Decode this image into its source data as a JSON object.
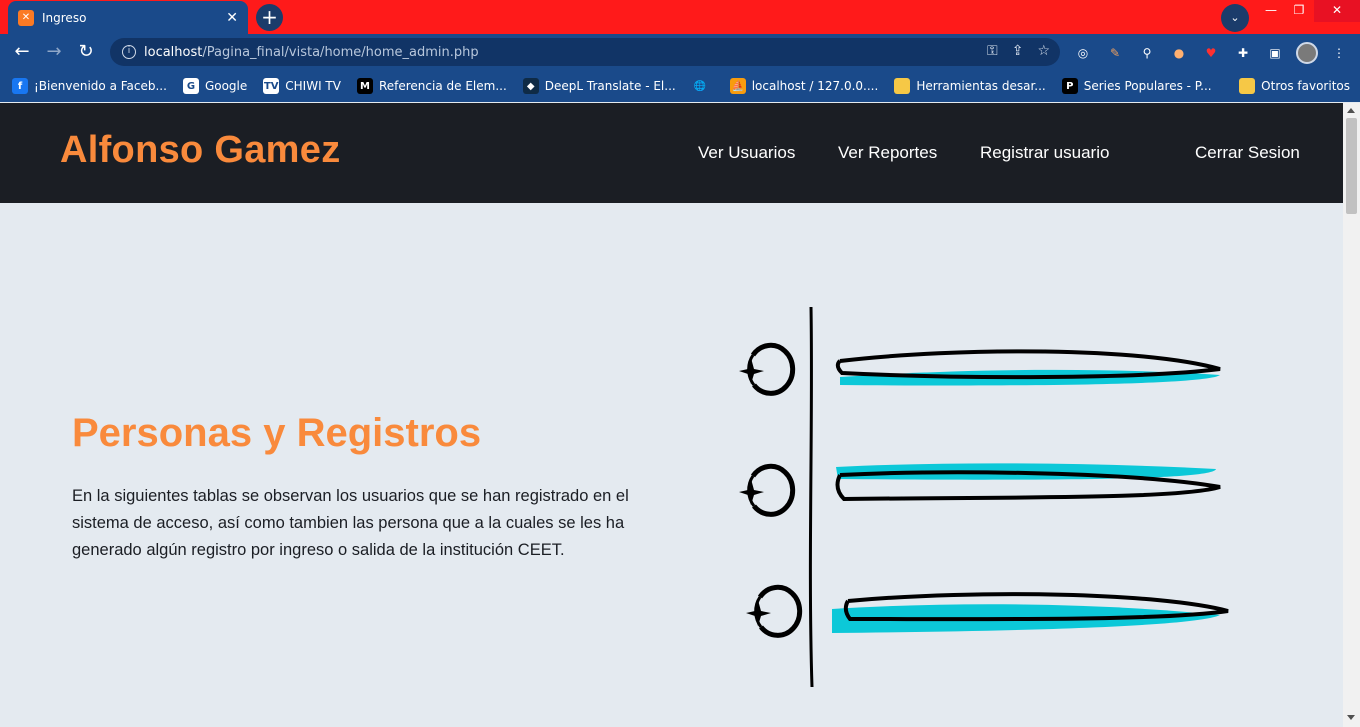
{
  "browser": {
    "tab_title": "Ingreso",
    "tab_favicon": "xampp-icon",
    "url_host": "localhost",
    "url_path": "/Pagina_final/vista/home/home_admin.php",
    "bookmarks": [
      {
        "label": "¡Bienvenido a Faceb...",
        "icon": "facebook-icon",
        "color": "#1877f2",
        "glyph": "f"
      },
      {
        "label": "Google",
        "icon": "google-icon",
        "color": "#ffffff",
        "glyph": "G"
      },
      {
        "label": "CHIWI TV",
        "icon": "tv-icon",
        "color": "#ffffff",
        "glyph": "TV"
      },
      {
        "label": "Referencia de Elem...",
        "icon": "mdn-icon",
        "color": "#000000",
        "glyph": "M"
      },
      {
        "label": "DeepL Translate - El...",
        "icon": "deepl-icon",
        "color": "#0f2b46",
        "glyph": "◆"
      },
      {
        "label": "",
        "icon": "globe-icon",
        "color": "#1a4a8a",
        "glyph": "🌐"
      },
      {
        "label": "localhost / 127.0.0....",
        "icon": "phpmyadmin-icon",
        "color": "#f89c0e",
        "glyph": "⛵"
      },
      {
        "label": "Herramientas desar...",
        "icon": "folder-icon",
        "color": "#f6c846",
        "glyph": ""
      },
      {
        "label": "Series Populares - P...",
        "icon": "p-icon",
        "color": "#000000",
        "glyph": "P"
      }
    ],
    "other_bookmarks": "Otros favoritos"
  },
  "site": {
    "brand": "Alfonso Gamez",
    "nav": [
      "Ver Usuarios",
      "Ver Reportes",
      "Registrar usuario",
      "Cerrar Sesion"
    ]
  },
  "hero": {
    "title": "Personas y Registros",
    "text": "En la siguientes tablas se observan los usuarios que se han registrado en el sistema de acceso, así como tambien las persona que a la cuales se les ha generado algún registro por ingreso o salida de la institución CEET."
  },
  "colors": {
    "accent": "#f98a3c",
    "header_bg": "#1b1e24",
    "page_bg": "#e4eaf0",
    "highlight": "#0cc8d8"
  }
}
